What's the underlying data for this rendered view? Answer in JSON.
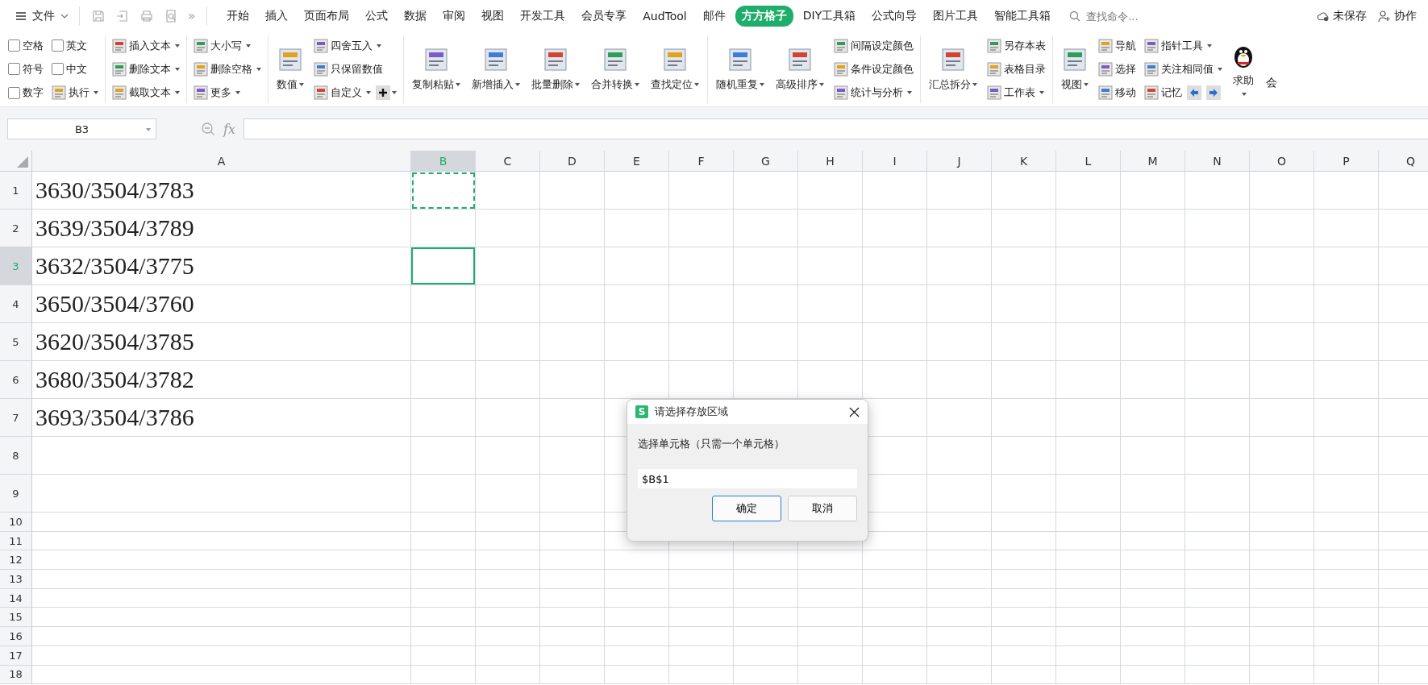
{
  "menu_bar": {
    "file_menu": "文件",
    "more": "»",
    "tabs": [
      {
        "label": "开始",
        "selected": false
      },
      {
        "label": "插入",
        "selected": false
      },
      {
        "label": "页面布局",
        "selected": false
      },
      {
        "label": "公式",
        "selected": false
      },
      {
        "label": "数据",
        "selected": false
      },
      {
        "label": "审阅",
        "selected": false
      },
      {
        "label": "视图",
        "selected": false
      },
      {
        "label": "开发工具",
        "selected": false
      },
      {
        "label": "会员专享",
        "selected": false
      },
      {
        "label": "AudTool",
        "selected": false
      },
      {
        "label": "邮件",
        "selected": false
      },
      {
        "label": "方方格子",
        "selected": true
      },
      {
        "label": "DIY工具箱",
        "selected": false
      },
      {
        "label": "公式向导",
        "selected": false
      },
      {
        "label": "图片工具",
        "selected": false
      },
      {
        "label": "智能工具箱",
        "selected": false
      }
    ],
    "search": {
      "placeholder": "查找命令..."
    },
    "save_status": "未保存",
    "collaborate": "协作"
  },
  "ribbon": {
    "groups": [
      {
        "columns": [
          [
            [
              {
                "kind": "checkbox",
                "label": "空格",
                "checked": false
              }
            ],
            [
              {
                "kind": "checkbox",
                "label": "符号",
                "checked": false
              }
            ],
            [
              {
                "kind": "checkbox",
                "label": "数字",
                "checked": false
              }
            ]
          ],
          [
            [
              {
                "kind": "checkbox",
                "label": "英文",
                "checked": false
              }
            ],
            [
              {
                "kind": "checkbox",
                "label": "中文",
                "checked": false
              }
            ],
            [
              {
                "kind": "small",
                "label": "执行",
                "dropdown": true
              }
            ]
          ]
        ]
      },
      {
        "columns": [
          [
            [
              {
                "kind": "small",
                "label": "插入文本",
                "dropdown": true
              }
            ],
            [
              {
                "kind": "small",
                "label": "删除文本",
                "dropdown": true
              }
            ],
            [
              {
                "kind": "small",
                "label": "截取文本",
                "dropdown": true
              }
            ]
          ]
        ]
      },
      {
        "columns": [
          [
            [
              {
                "kind": "small",
                "label": "大小写",
                "dropdown": true
              }
            ],
            [
              {
                "kind": "small",
                "label": "删除空格",
                "dropdown": true
              }
            ],
            [
              {
                "kind": "small",
                "label": "更多",
                "dropdown": true
              }
            ]
          ]
        ]
      },
      {
        "columns": [
          [
            [
              {
                "kind": "large",
                "label": "数值",
                "dropdown": true
              }
            ]
          ],
          [
            [
              {
                "kind": "small",
                "label": "四舍五入",
                "dropdown": true
              }
            ],
            [
              {
                "kind": "small",
                "label": "只保留数值",
                "dropdown": false
              }
            ],
            [
              {
                "kind": "small",
                "label": "自定义",
                "dropdown": true
              },
              {
                "kind": "plus",
                "dropdown": true
              }
            ]
          ]
        ]
      },
      {
        "columns": [
          [
            [
              {
                "kind": "large",
                "label": "复制粘贴",
                "dropdown": true
              }
            ]
          ],
          [
            [
              {
                "kind": "large",
                "label": "新增插入",
                "dropdown": true
              }
            ]
          ],
          [
            [
              {
                "kind": "large",
                "label": "批量删除",
                "dropdown": true
              }
            ]
          ],
          [
            [
              {
                "kind": "large",
                "label": "合并转换",
                "dropdown": true
              }
            ]
          ],
          [
            [
              {
                "kind": "large",
                "label": "查找定位",
                "dropdown": true
              }
            ]
          ]
        ]
      },
      {
        "columns": [
          [
            [
              {
                "kind": "large",
                "label": "随机重复",
                "dropdown": true
              }
            ]
          ],
          [
            [
              {
                "kind": "large",
                "label": "高级排序",
                "dropdown": true
              }
            ]
          ],
          [
            [
              {
                "kind": "small",
                "label": "间隔设定颜色",
                "dropdown": false
              }
            ],
            [
              {
                "kind": "small",
                "label": "条件设定颜色",
                "dropdown": false
              }
            ],
            [
              {
                "kind": "small",
                "label": "统计与分析",
                "dropdown": true
              }
            ]
          ]
        ]
      },
      {
        "columns": [
          [
            [
              {
                "kind": "large",
                "label": "汇总拆分",
                "dropdown": true
              }
            ]
          ],
          [
            [
              {
                "kind": "small",
                "label": "另存本表",
                "dropdown": false
              }
            ],
            [
              {
                "kind": "small",
                "label": "表格目录",
                "dropdown": false
              }
            ],
            [
              {
                "kind": "small",
                "label": "工作表",
                "dropdown": true
              }
            ]
          ]
        ]
      },
      {
        "columns": [
          [
            [
              {
                "kind": "large",
                "label": "视图",
                "dropdown": true
              }
            ]
          ],
          [
            [
              {
                "kind": "small",
                "label": "导航",
                "dropdown": false
              }
            ],
            [
              {
                "kind": "small",
                "label": "选择",
                "dropdown": false
              }
            ],
            [
              {
                "kind": "small",
                "label": "移动",
                "dropdown": false
              }
            ]
          ],
          [
            [
              {
                "kind": "small",
                "label": "指针工具",
                "dropdown": true
              }
            ],
            [
              {
                "kind": "small",
                "label": "关注相同值",
                "dropdown": true
              }
            ],
            [
              {
                "kind": "small",
                "label": "记忆",
                "dropdown": false
              },
              {
                "kind": "left"
              },
              {
                "kind": "right"
              }
            ]
          ]
        ]
      },
      {
        "columns": [
          [
            [
              {
                "kind": "tall",
                "label": "求助",
                "dropdown": true
              }
            ]
          ],
          [
            [
              {
                "kind": "cut",
                "label": "会"
              }
            ]
          ]
        ]
      }
    ]
  },
  "formula_bar": {
    "name_box": "B3",
    "fx": "fx"
  },
  "sheet": {
    "columns": [
      {
        "label": "A",
        "selected": false
      },
      {
        "label": "B",
        "selected": true
      },
      {
        "label": "C",
        "selected": false
      },
      {
        "label": "D",
        "selected": false
      },
      {
        "label": "E",
        "selected": false
      },
      {
        "label": "F",
        "selected": false
      },
      {
        "label": "G",
        "selected": false
      },
      {
        "label": "H",
        "selected": false
      },
      {
        "label": "I",
        "selected": false
      },
      {
        "label": "J",
        "selected": false
      },
      {
        "label": "K",
        "selected": false
      },
      {
        "label": "L",
        "selected": false
      },
      {
        "label": "M",
        "selected": false
      },
      {
        "label": "N",
        "selected": false
      },
      {
        "label": "O",
        "selected": false
      },
      {
        "label": "P",
        "selected": false
      },
      {
        "label": "Q",
        "selected": false
      }
    ],
    "rows": [
      {
        "label": "1",
        "selected": false,
        "copy_marquee": true,
        "value": "3630/3504/3783"
      },
      {
        "label": "2",
        "selected": false,
        "copy_marquee": false,
        "value": "3639/3504/3789"
      },
      {
        "label": "3",
        "selected": true,
        "copy_marquee": false,
        "value": "3632/3504/3775"
      },
      {
        "label": "4",
        "selected": false,
        "copy_marquee": false,
        "value": "3650/3504/3760"
      },
      {
        "label": "5",
        "selected": false,
        "copy_marquee": false,
        "value": "3620/3504/3785"
      },
      {
        "label": "6",
        "selected": false,
        "copy_marquee": false,
        "value": "3680/3504/3782"
      },
      {
        "label": "7",
        "selected": false,
        "copy_marquee": false,
        "value": "3693/3504/3786"
      },
      {
        "label": "8",
        "selected": false,
        "copy_marquee": false
      },
      {
        "label": "9",
        "selected": false,
        "copy_marquee": false
      },
      {
        "label": "10",
        "selected": false,
        "copy_marquee": false
      },
      {
        "label": "11",
        "selected": false,
        "copy_marquee": false
      },
      {
        "label": "12",
        "selected": false,
        "copy_marquee": false
      },
      {
        "label": "13",
        "selected": false,
        "copy_marquee": false
      },
      {
        "label": "14",
        "selected": false,
        "copy_marquee": false
      },
      {
        "label": "15",
        "selected": false,
        "copy_marquee": false
      },
      {
        "label": "16",
        "selected": false,
        "copy_marquee": false
      },
      {
        "label": "17",
        "selected": false,
        "copy_marquee": false
      },
      {
        "label": "18",
        "selected": false,
        "copy_marquee": false
      }
    ]
  },
  "dialog": {
    "app_icon": "S",
    "title": "请选择存放区域",
    "message": "选择单元格（只需一个单元格）",
    "value": "$B$1",
    "buttons": [
      {
        "label": "确定",
        "primary": true
      },
      {
        "label": "取消",
        "primary": false
      }
    ]
  }
}
